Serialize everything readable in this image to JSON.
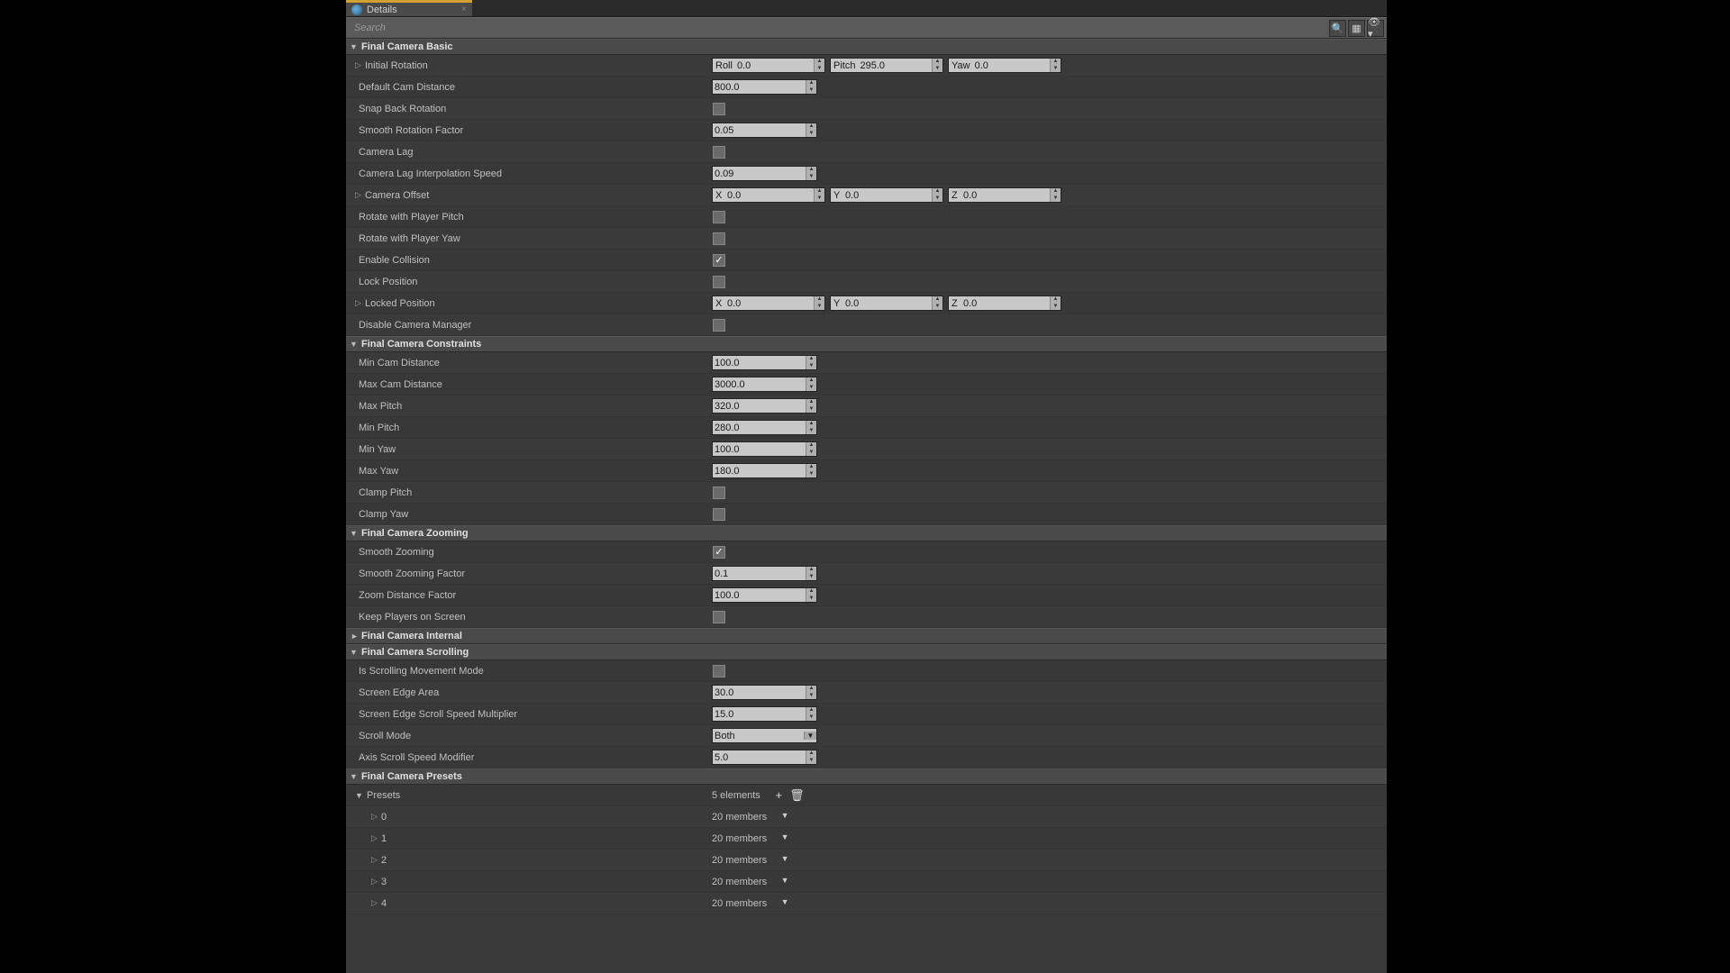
{
  "tab": {
    "title": "Details"
  },
  "search": {
    "placeholder": "Search"
  },
  "sections": {
    "basic": {
      "title": "Final Camera Basic",
      "initial_rotation": {
        "label": "Initial Rotation",
        "roll_l": "Roll",
        "roll_v": "0.0",
        "pitch_l": "Pitch",
        "pitch_v": "295.0",
        "yaw_l": "Yaw",
        "yaw_v": "0.0"
      },
      "default_cam_distance": {
        "label": "Default Cam Distance",
        "value": "800.0"
      },
      "snap_back_rotation": {
        "label": "Snap Back Rotation",
        "checked": false
      },
      "smooth_rotation_factor": {
        "label": "Smooth Rotation Factor",
        "value": "0.05"
      },
      "camera_lag": {
        "label": "Camera Lag",
        "checked": false
      },
      "camera_lag_interp_speed": {
        "label": "Camera Lag Interpolation Speed",
        "value": "0.09"
      },
      "camera_offset": {
        "label": "Camera Offset",
        "xl": "X",
        "xv": "0.0",
        "yl": "Y",
        "yv": "0.0",
        "zl": "Z",
        "zv": "0.0"
      },
      "rotate_with_player_pitch": {
        "label": "Rotate with Player Pitch",
        "checked": false
      },
      "rotate_with_player_yaw": {
        "label": "Rotate with Player Yaw",
        "checked": false
      },
      "enable_collision": {
        "label": "Enable Collision",
        "checked": true
      },
      "lock_position": {
        "label": "Lock Position",
        "checked": false
      },
      "locked_position": {
        "label": "Locked Position",
        "xl": "X",
        "xv": "0.0",
        "yl": "Y",
        "yv": "0.0",
        "zl": "Z",
        "zv": "0.0"
      },
      "disable_camera_manager": {
        "label": "Disable Camera Manager",
        "checked": false
      }
    },
    "constraints": {
      "title": "Final Camera Constraints",
      "min_cam_distance": {
        "label": "Min Cam Distance",
        "value": "100.0"
      },
      "max_cam_distance": {
        "label": "Max Cam Distance",
        "value": "3000.0"
      },
      "max_pitch": {
        "label": "Max Pitch",
        "value": "320.0"
      },
      "min_pitch": {
        "label": "Min Pitch",
        "value": "280.0"
      },
      "min_yaw": {
        "label": "Min Yaw",
        "value": "100.0"
      },
      "max_yaw": {
        "label": "Max Yaw",
        "value": "180.0"
      },
      "clamp_pitch": {
        "label": "Clamp Pitch",
        "checked": false
      },
      "clamp_yaw": {
        "label": "Clamp Yaw",
        "checked": false
      }
    },
    "zooming": {
      "title": "Final Camera Zooming",
      "smooth_zooming": {
        "label": "Smooth Zooming",
        "checked": true
      },
      "smooth_zooming_factor": {
        "label": "Smooth Zooming Factor",
        "value": "0.1"
      },
      "zoom_distance_factor": {
        "label": "Zoom Distance Factor",
        "value": "100.0"
      },
      "keep_players_on_screen": {
        "label": "Keep Players on Screen",
        "checked": false
      }
    },
    "internal": {
      "title": "Final Camera Internal"
    },
    "scrolling": {
      "title": "Final Camera Scrolling",
      "is_scrolling_movement_mode": {
        "label": "Is Scrolling Movement Mode",
        "checked": false
      },
      "screen_edge_area": {
        "label": "Screen Edge Area",
        "value": "30.0"
      },
      "screen_edge_scroll_speed_multiplier": {
        "label": "Screen Edge Scroll Speed Multiplier",
        "value": "15.0"
      },
      "scroll_mode": {
        "label": "Scroll Mode",
        "value": "Both"
      },
      "axis_scroll_speed_modifier": {
        "label": "Axis Scroll Speed Modifier",
        "value": "5.0"
      }
    },
    "presets": {
      "title": "Final Camera Presets",
      "presets_label": "Presets",
      "elements_text": "5 elements",
      "member_text": "20 members",
      "items": [
        "0",
        "1",
        "2",
        "3",
        "4"
      ]
    }
  }
}
